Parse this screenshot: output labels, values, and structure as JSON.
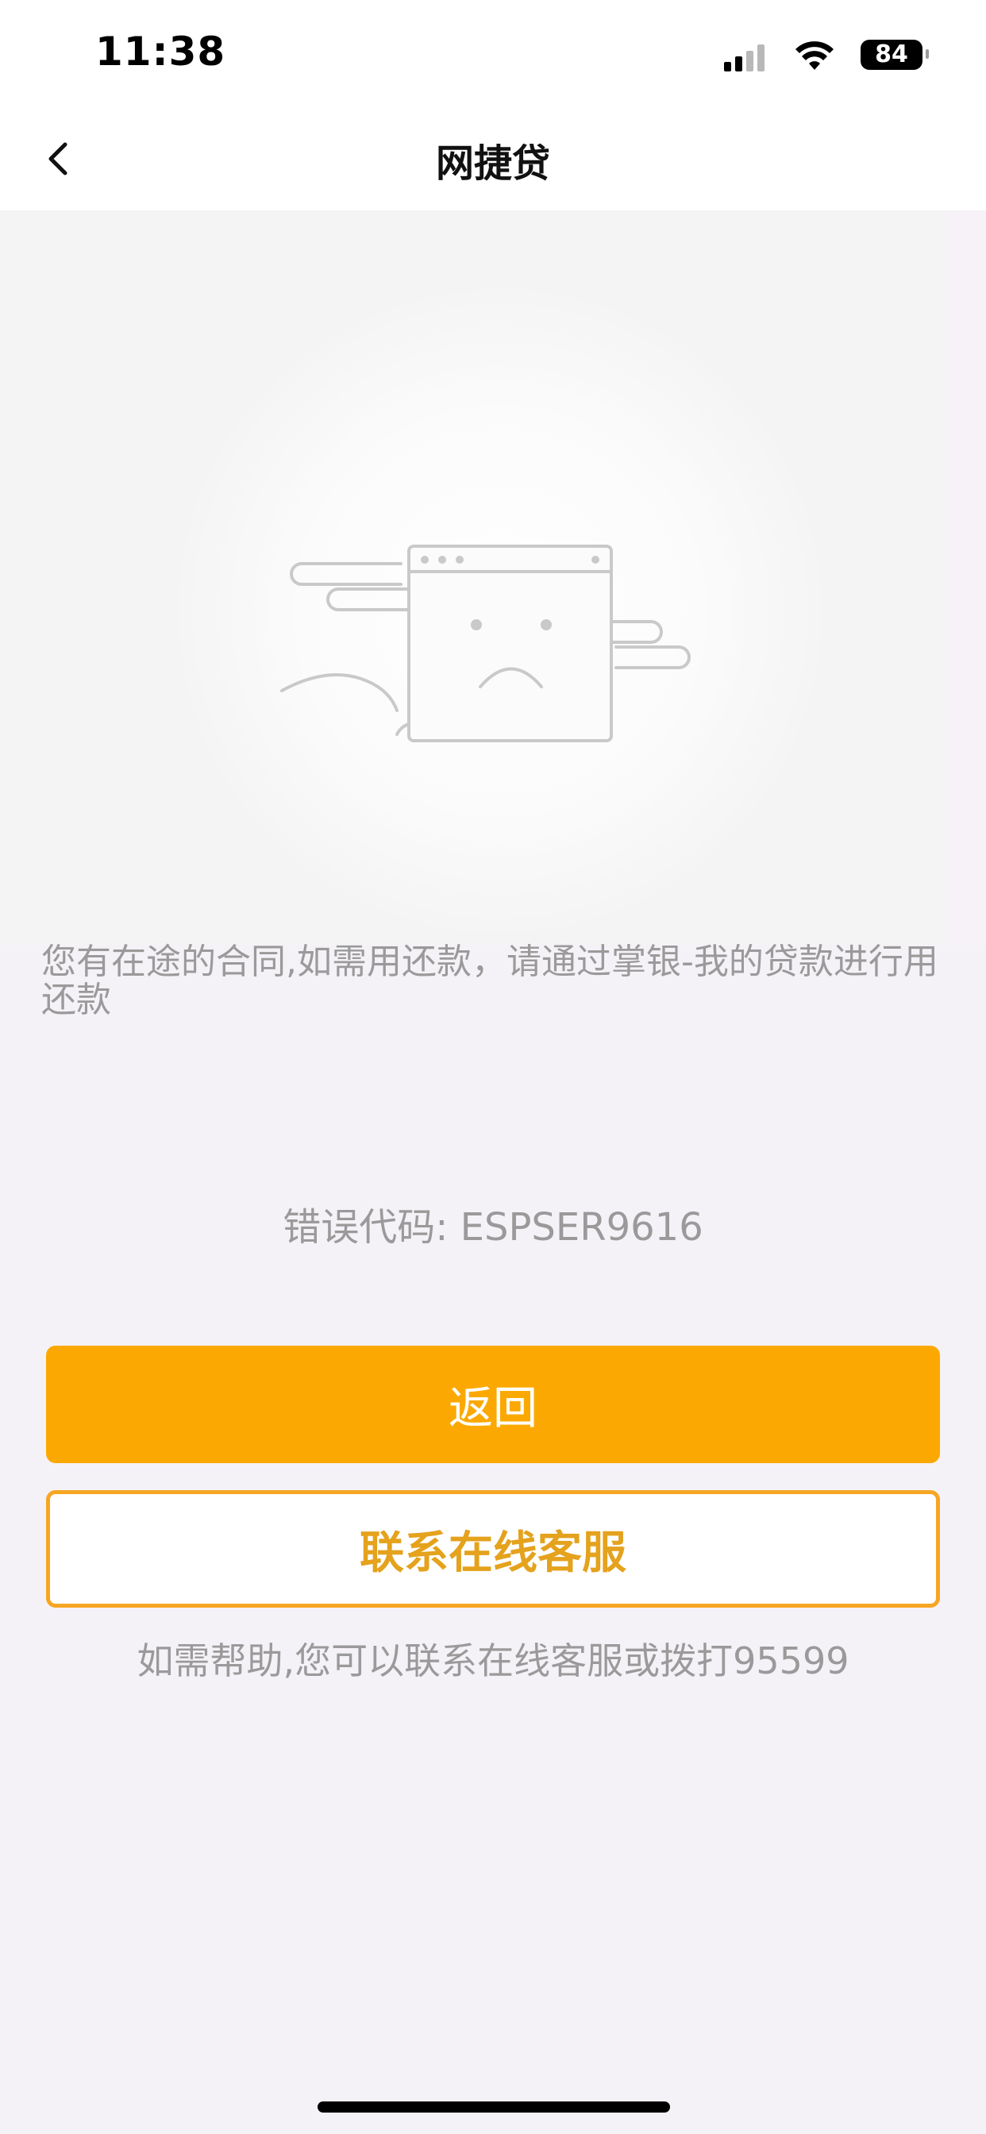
{
  "status_bar": {
    "time": "11:38",
    "battery": "84",
    "icons": [
      "signal-icon",
      "wifi-icon",
      "battery-icon"
    ]
  },
  "nav": {
    "title": "网捷贷",
    "back_icon": "chevron-left-icon"
  },
  "illustration": {
    "icon": "sad-browser-window-icon"
  },
  "content": {
    "message": "您有在途的合同,如需用还款，请通过掌银-我的贷款进行用还款",
    "error_code": "错误代码: ESPSER9616"
  },
  "buttons": {
    "return_label": "返回",
    "service_label": "联系在线客服"
  },
  "help": {
    "text": "如需帮助,您可以联系在线客服或拨打95599"
  },
  "colors": {
    "accent": "#fba902",
    "outline": "#f6a623",
    "muted_text": "#9a9a9a",
    "page_background": "#f5f2f7"
  }
}
